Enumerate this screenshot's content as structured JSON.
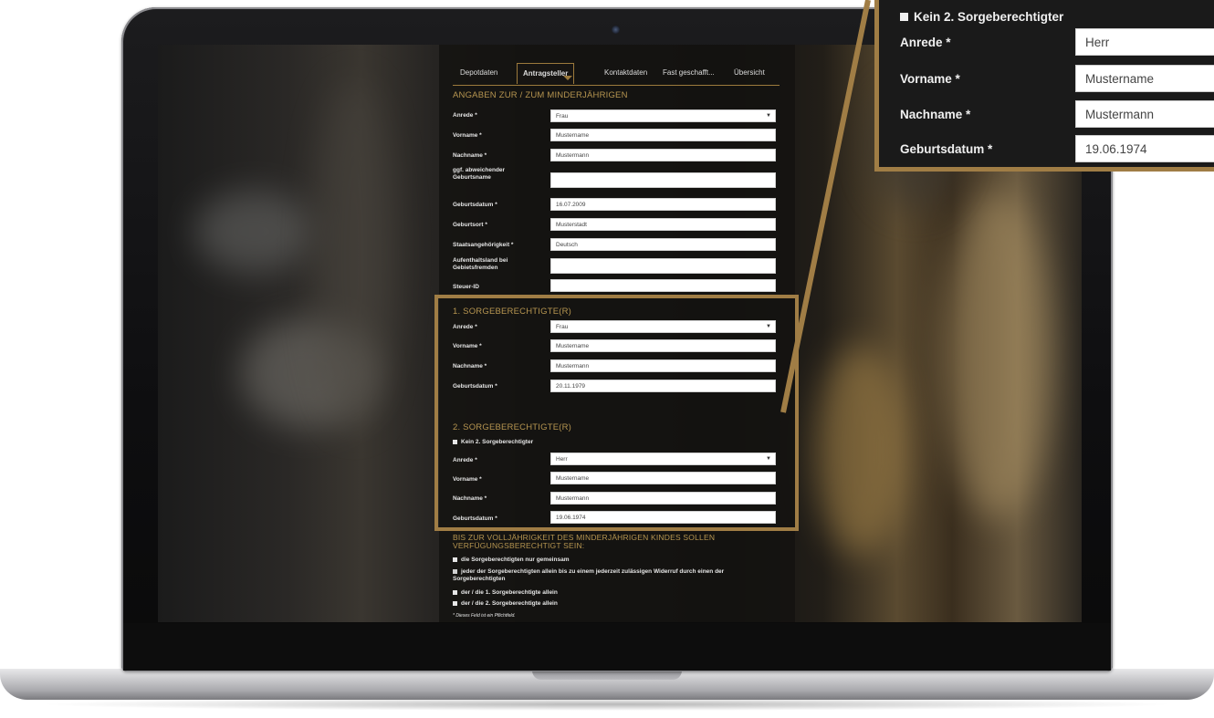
{
  "tabs": [
    "Depotdaten",
    "Antragsteller",
    "Kontaktdaten",
    "Fast geschafft...",
    "Übersicht"
  ],
  "active_tab": "Antragsteller",
  "minor": {
    "heading": "ANGABEN ZUR / ZUM MINDERJÄHRIGEN",
    "anrede_label": "Anrede *",
    "anrede_value": "Frau",
    "vorname_label": "Vorname *",
    "vorname_value": "Mustername",
    "nachname_label": "Nachname *",
    "nachname_value": "Mustermann",
    "geburtsname_label": "ggf. abweichender Geburtsname",
    "geburtsname_value": "",
    "geburtsdatum_label": "Geburtsdatum *",
    "geburtsdatum_value": "16.07.2009",
    "geburtsort_label": "Geburtsort *",
    "geburtsort_value": "Musterstadt",
    "staat_label": "Staatsangehörigkeit *",
    "staat_value": "Deutsch",
    "aufenthalt_label": "Aufenthaltsland bei Gebietsfremden",
    "aufenthalt_value": "",
    "steuer_label": "Steuer-ID",
    "steuer_value": ""
  },
  "guardian1": {
    "heading": "1. SORGEBERECHTIGTE(R)",
    "anrede_label": "Anrede *",
    "anrede_value": "Frau",
    "vorname_label": "Vorname *",
    "vorname_value": "Mustername",
    "nachname_label": "Nachname *",
    "nachname_value": "Mustermann",
    "geburtsdatum_label": "Geburtsdatum *",
    "geburtsdatum_value": "20.11.1979"
  },
  "guardian2": {
    "heading": "2. SORGEBERECHTIGTE(R)",
    "none_label": "Kein 2. Sorgeberechtigter",
    "anrede_label": "Anrede *",
    "anrede_value": "Herr",
    "vorname_label": "Vorname *",
    "vorname_value": "Mustername",
    "nachname_label": "Nachname *",
    "nachname_value": "Mustermann",
    "geburtsdatum_label": "Geburtsdatum *",
    "geburtsdatum_value": "19.06.1974"
  },
  "authority": {
    "heading": "BIS ZUR VOLLJÄHRIGKEIT DES MINDERJÄHRIGEN KINDES SOLLEN VERFÜGUNGSBERECHTIGT SEIN:",
    "options": [
      "die Sorgeberechtigten nur gemeinsam",
      "jeder der Sorgeberechtigten allein bis zu einem jederzeit zulässigen Widerruf durch einen der Sorgeberechtigten",
      "der / die 1. Sorgeberechtigte allein",
      "der / die 2. Sorgeberechtigte allein"
    ],
    "footnote": "* Dieses Feld ist ein Pflichtfeld."
  },
  "callout": {
    "none_label": "Kein 2. Sorgeberechtigter",
    "anrede_label": "Anrede *",
    "anrede_value": "Herr",
    "vorname_label": "Vorname *",
    "vorname_value": "Mustername",
    "nachname_label": "Nachname *",
    "nachname_value": "Mustermann",
    "geburtsdatum_label": "Geburtsdatum *",
    "geburtsdatum_value": "19.06.1974"
  },
  "colors": {
    "accent_gold": "#a07d45",
    "panel_bg": "#141210",
    "input_bg": "#ffffff"
  }
}
